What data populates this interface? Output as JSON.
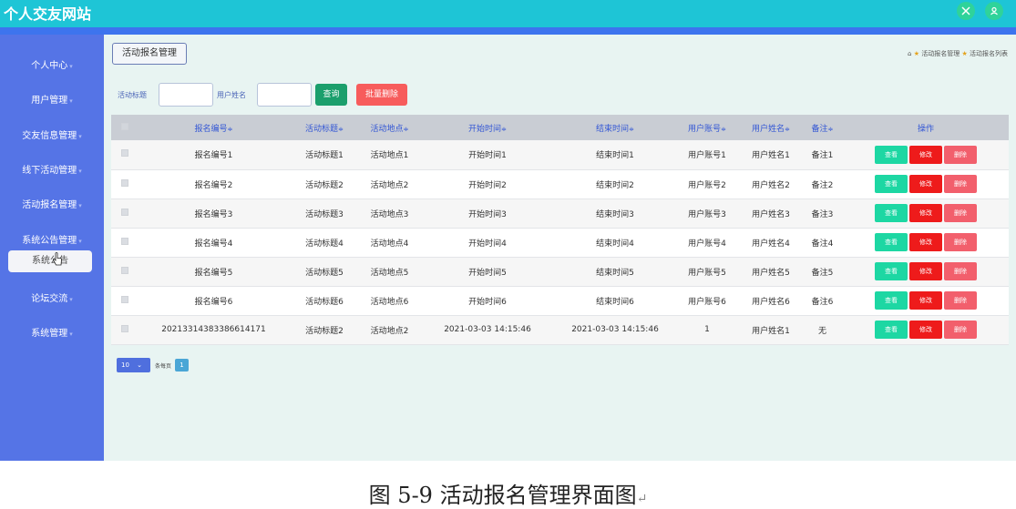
{
  "app": {
    "title": "个人交友网站",
    "top_icons": [
      "fullscreen-icon",
      "user-icon"
    ]
  },
  "sidebar": {
    "items": [
      {
        "label": "个人中心"
      },
      {
        "label": "用户管理"
      },
      {
        "label": "交友信息管理"
      },
      {
        "label": "线下活动管理"
      },
      {
        "label": "活动报名管理"
      },
      {
        "label": "系统公告管理"
      },
      {
        "label": "论坛交流"
      },
      {
        "label": "系统管理"
      }
    ],
    "active_sub": "系统公告"
  },
  "header": {
    "title_button": "活动报名管理",
    "breadcrumb": [
      "活动报名管理",
      "活动报名列表"
    ]
  },
  "search": {
    "field1_label": "活动标题",
    "field2_label": "用户姓名",
    "query_label": "查询",
    "batch_delete_label": "批量删除"
  },
  "table": {
    "columns": [
      "报名编号",
      "活动标题",
      "活动地点",
      "开始时间",
      "结束时间",
      "用户账号",
      "用户姓名",
      "备注",
      "操作"
    ],
    "rows": [
      [
        "报名编号1",
        "活动标题1",
        "活动地点1",
        "开始时间1",
        "结束时间1",
        "用户账号1",
        "用户姓名1",
        "备注1"
      ],
      [
        "报名编号2",
        "活动标题2",
        "活动地点2",
        "开始时间2",
        "结束时间2",
        "用户账号2",
        "用户姓名2",
        "备注2"
      ],
      [
        "报名编号3",
        "活动标题3",
        "活动地点3",
        "开始时间3",
        "结束时间3",
        "用户账号3",
        "用户姓名3",
        "备注3"
      ],
      [
        "报名编号4",
        "活动标题4",
        "活动地点4",
        "开始时间4",
        "结束时间4",
        "用户账号4",
        "用户姓名4",
        "备注4"
      ],
      [
        "报名编号5",
        "活动标题5",
        "活动地点5",
        "开始时间5",
        "结束时间5",
        "用户账号5",
        "用户姓名5",
        "备注5"
      ],
      [
        "报名编号6",
        "活动标题6",
        "活动地点6",
        "开始时间6",
        "结束时间6",
        "用户账号6",
        "用户姓名6",
        "备注6"
      ],
      [
        "20213314383386614171",
        "活动标题2",
        "活动地点2",
        "2021-03-03 14:15:46",
        "2021-03-03 14:15:46",
        "1",
        "用户姓名1",
        "无"
      ]
    ],
    "actions": {
      "view": "查看",
      "edit": "修改",
      "delete": "删除"
    }
  },
  "pagination": {
    "page_size": "10",
    "page_size_label": "条每页",
    "current_page": "1"
  },
  "caption": "图 5-9 活动报名管理界面图",
  "colors": {
    "topbar": "#1ec5d6",
    "sidebar": "#5574e6",
    "content_bg": "#e8f4f2",
    "view_button": "#1dd7a3",
    "edit_button": "#ee1b1b",
    "delete_button": "#f25f6c",
    "query_button": "#1b9f6c",
    "batch_delete_button": "#f75c5c"
  }
}
